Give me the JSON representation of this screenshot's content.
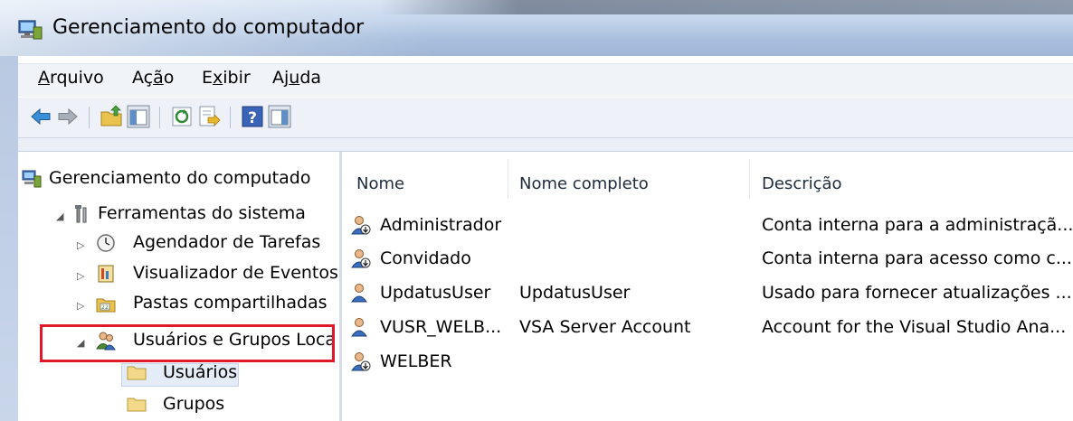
{
  "window": {
    "title": "Gerenciamento do computador"
  },
  "menu": [
    "Arquivo",
    "Ação",
    "Exibir",
    "Ajuda"
  ],
  "toolbar": {
    "buttons": [
      "back-arrow-icon",
      "forward-arrow-icon",
      "up-folder-icon",
      "show-hide-console-tree-icon",
      "refresh-icon",
      "export-list-icon",
      "help-icon",
      "show-hide-action-pane-icon"
    ]
  },
  "tree": {
    "root": "Gerenciamento do computado",
    "system_tools": "Ferramentas do sistema",
    "task_scheduler": "Agendador de Tarefas",
    "event_viewer": "Visualizador de Eventos",
    "shared_folders": "Pastas compartilhadas",
    "local_users_groups": "Usuários e Grupos Loca",
    "users": "Usuários",
    "groups": "Grupos"
  },
  "list": {
    "columns": [
      "Nome",
      "Nome completo",
      "Descrição"
    ],
    "rows": [
      {
        "name": "Administrador",
        "full_name": "",
        "description": "Conta interna para a administraçã...",
        "icon": "disabled-user-icon"
      },
      {
        "name": "Convidado",
        "full_name": "",
        "description": "Conta interna para acesso como c...",
        "icon": "disabled-user-icon"
      },
      {
        "name": "UpdatusUser",
        "full_name": "UpdatusUser",
        "description": "Usado para fornecer atualizações ...",
        "icon": "user-icon"
      },
      {
        "name": "VUSR_WELB...",
        "full_name": "VSA Server Account",
        "description": "Account for the Visual Studio Ana...",
        "icon": "user-icon"
      },
      {
        "name": "WELBER",
        "full_name": "",
        "description": "",
        "icon": "disabled-user-icon"
      }
    ]
  },
  "highlight": {
    "color": "#e0182a",
    "target": "Usuários e Grupos Loca"
  }
}
